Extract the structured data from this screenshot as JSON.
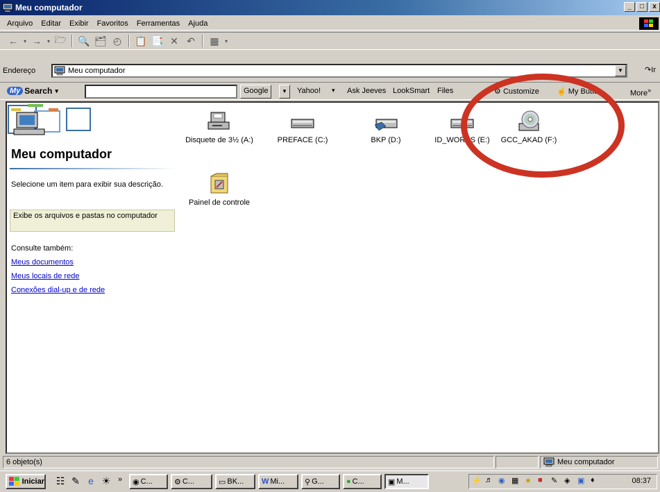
{
  "window": {
    "title": "Meu computador",
    "controls": [
      "_",
      " ",
      "x"
    ]
  },
  "menu": [
    "Arquivo",
    "Editar",
    "Exibir",
    "Favoritos",
    "Ferramentas",
    "Ajuda"
  ],
  "address": {
    "label": "Endereço",
    "value": "Meu computador",
    "go": "Ir"
  },
  "search": {
    "brand_my": "My",
    "brand": "Search",
    "button": "Google",
    "links": [
      "Yahoo!",
      "Ask Jeeves",
      "LookSmart",
      "Files",
      "Customize",
      "My Button",
      "More"
    ]
  },
  "left_panel": {
    "title": "Meu computador",
    "description": "Selecione um item para exibir sua descrição.",
    "info": "Exibe os arquivos e pastas no computador",
    "see_also": "Consulte também:",
    "links": [
      "Meus documentos",
      "Meus locais de rede",
      "Conexões dial-up e de rede"
    ]
  },
  "items": [
    {
      "label": "Disquete de 3½ (A:)",
      "icon": "floppy-drive-icon"
    },
    {
      "label": "PREFACE (C:)",
      "icon": "hard-drive-icon"
    },
    {
      "label": "BKP (D:)",
      "icon": "shared-drive-icon"
    },
    {
      "label": "ID_WORKS (E:)",
      "icon": "hard-drive-icon"
    },
    {
      "label": "GCC_AKAD (F:)",
      "icon": "cd-drive-icon"
    },
    {
      "label": "Painel de controle",
      "icon": "control-panel-icon"
    }
  ],
  "status": {
    "count": "6 objeto(s)",
    "location": "Meu computador"
  },
  "taskbar": {
    "start": "Iniciar",
    "buttons": [
      "C...",
      "C...",
      "BK...",
      "Mi...",
      "G...",
      "C...",
      "M..."
    ],
    "clock": "08:37"
  },
  "colors": {
    "titlebar_start": "#0a246a",
    "annotation": "#cc3322",
    "link": "#0000cc"
  }
}
